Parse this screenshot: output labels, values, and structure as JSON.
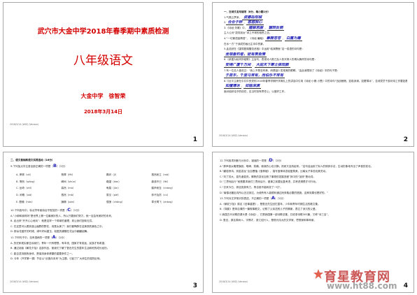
{
  "slide1": {
    "school": "武穴市大金中学2018年春季期中素质检测",
    "title": "八年级语文",
    "author": "大金中学　徐智荣",
    "date": "2018年3月14日",
    "footer": "2018/3/14 (WIZ) (Version)",
    "number": "1"
  },
  "slide2": {
    "heading": "一、古诗文名句填写（8分，每小题1分）",
    "lines": [
      "1.气蒸云梦泽，",
      "2.",
      "3.《诗经·关雎》中，",
      "主人公对“窈窕淑女”求之不得的相思之苦。",
      "4.“一切景语皆情语”，《诗经·蒹葭》",
      "在水一方”于读成的画出主诗中的景。",
      "5.孟浩然在《望洞庭湖赠张丞相》中运用“临渊羡鱼”这一成语的诗句是：",
      "",
      "6.《茅屋为秋风所破歌》主旨句，表现诗人推己及人悲天悯人的博大胸怀的诗句是：",
      "",
      "7.有一位名人曾说过：“我上不是没有美，而是缺少发现美的眼睛。”由此我想到了《诗经》中的句子是：",
      "",
      "8.习近平主席在中共中央党校2018年春季学期开学典礼上的讲话中引用《诗经·小雅·小旻》中的诗句“战战兢兢，如临深渊，如履薄冰”，告诫党员干部对待工作要如履薄冰。",
      "面对组织给予的信任，应当时刻有责任心，以做好工作。"
    ],
    "answers": {
      "a1": "波撼岳阳城",
      "a2a": "合合于桥",
      "a2b": "悠悠我心",
      "a3a": "寤寐思服",
      "a3b": "辗转反侧",
      "a4a": "蒹葭苍苍",
      "a4b": "白露为霜",
      "a5": "坐观垂钓者，徒有羡鱼情",
      "a6a": "安得广厦千万间",
      "a6b": "大庇天下寒士俱欢颜",
      "a7": "于是乎，千里马常有，而伯乐不常有",
      "a8a": "如履薄冰",
      "a8b": "如临深渊"
    },
    "footer": "2018/3/14 (WIZ) (Version)",
    "number": "2"
  },
  "slide3": {
    "heading": "二、语文基础和语文实践活动（16分）",
    "q9": "9.下列加点字注音全部正确的一项是（",
    "q9_answer": "B",
    "q9_tail": "）（2分）",
    "grid": [
      [
        "A. 摩擦（cā）",
        "翡翠（fěi）",
        "羁绊（jī）",
        "蓦然而立（mò）"
      ],
      [
        "B. 惘然（wǎng）",
        "瞬间（shùn）",
        "瞰望（kàn）",
        "鼎沸不已（fèi）"
      ],
      [
        "C. 旨奇（zhǐ）",
        "暮然（mù）",
        "龟裂（jūn）",
        "鹤声而至（cháng）"
      ],
      [
        "D. 闲暇（xiá）",
        "蓦然（mò）",
        "瞥见（piē）",
        "猝不及防（cù）"
      ],
      [
        "E. 酣睡（hān）",
        "蹒跚（pán）",
        "憧憬（chōng）",
        "草长莺飞（zhǎng）"
      ]
    ],
    "q10": "10.下列各句中，标点符号使用合乎规范的一项是（",
    "q10_answer": "C",
    "q10_tail": "）（2分）",
    "q10_options": [
      "A.“小柳和我妈妈”是世界上第一位最美妙的人，所以只要我们努力，就一定会有美好的未来。",
      "B. 走出来“开开心心地玩”：就是这样一个简单的道理，却让我们回味无穷。",
      "C. 在这里可以看到漫山遍野的野花，真是太美了！我们都陶醉在这美丽的景色之中。",
      "D. 那朵花盛开的时候，绿叶好似碧玉，轻盈的蝴蝶在花丛中翩翩起舞。"
    ],
    "q11": "11.下列句子中，没有语病的一项是（",
    "q11_answer": "A",
    "q11_tail": "）（2分）",
    "q11_options": [
      "A. 历史和现实都告诉我们，青年一代有理想，有本领，国家才有前途，民族才有希望。",
      "B. 通过阅读《朝花夕拾》这部作品，使我们了解了鲁迅先生的童年生活和他的成长经历。",
      "C. 能否坚持锻炼身体，是保持身体健康的重要条件之一。",
      "D. 今年（开学第一课）节目以“创造向未来”为主题，引起了广大师生的强烈反响。"
    ],
    "footer": "2018/3/14 (WIZ) (Version)",
    "number": "3"
  },
  "slide4": {
    "q12": "12.下列各项判断与分析中，错误的一项是（",
    "q12_answer": "D",
    "q12_tail": "）（2分）",
    "lines": [
      "A.“那声音太略是旗浪，咆哮，悲痛，使我的心也沉静；然而又自然起来。”这句话运用了拟人的修辞手法，生动形象地写出了声音的变化。",
      "B.“翩若惊鸿，宛若游龙”出自曹植《洛神赋》，描写洛神体态轻盈柔美，比喻女子体态优美灵动。",
      "C.“刘了苏大，葛先诸葛亮，情势的变化加快了事物的发展进程”其中的“加快”是动词。",
      "D.“三思而后行”就是要求我们三思而后行，做事之前要反复考虑，并考虑清楚才可行动。",
      "C.“去来今日，奔如流泉有力，再也绝不能转变了一切”。",
      "D.“南辕北辙走向所以无法到达，为使所有人能顺利通过而采取必要的措施，这种效果也是好的。”",
      "13.下列对文学常识的表述，不正确的一项是（",
      "A.《朝花夕拾》原名《旧事重提》，是鲁迅先生回忆童年、少年和青年时期生活的散文集。",
      "B.《背影》是朱自清的一篇叙事散文，记叙了父亲送别儿子的情景，表达了深沉的父爱。",
      "C.我国古代诗歌的源头是《诗经》，它是我国第一部诗歌总集，共收录诗歌305篇，又称“诗三百”。",
      "D. 鲁迅，原名周树人，字豫才，浙江绍兴人，是现代伟大的文学家、思想家和革命家。"
    ],
    "q13_answer": "A",
    "footer": "2018/3/14 (WIZ) (Version)",
    "number": "4"
  },
  "watermark": {
    "text": "育星教育网",
    "url": "www.ht88.com"
  },
  "colors": {
    "title_red": "#d40000",
    "answer_blue": "#1c1cb4",
    "border": "#a9a9a9"
  }
}
